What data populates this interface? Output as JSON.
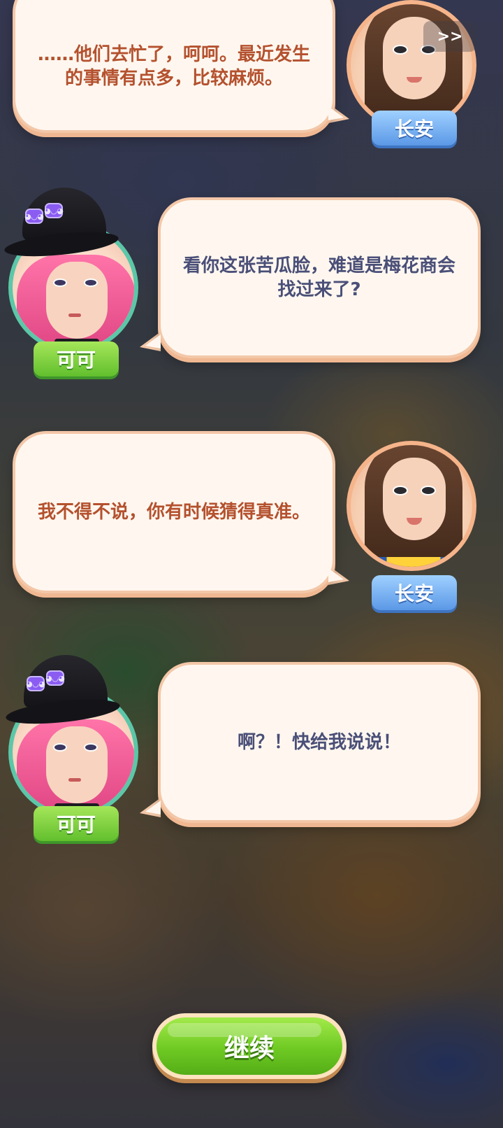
{
  "ui": {
    "skip_label": ">>",
    "continue_label": "继续"
  },
  "characters": {
    "changan": {
      "name": "长安"
    },
    "keke": {
      "name": "可可",
      "pin_glyph": "◕◡◕"
    }
  },
  "dialogue": [
    {
      "speaker": "长安",
      "text": "……他们去忙了，呵呵。最近发生的事情有点多，比较麻烦。"
    },
    {
      "speaker": "可可",
      "text": "看你这张苦瓜脸，难道是梅花商会找过来了?"
    },
    {
      "speaker": "长安",
      "text": "我不得不说，你有时候猜得真准。"
    },
    {
      "speaker": "可可",
      "text": "啊？！快给我说说！"
    }
  ],
  "colors": {
    "changan_text": "#b4512e",
    "keke_text": "#4a4f78",
    "bubble_fill": "#fff7ef",
    "bubble_border": "#f3c7a8",
    "continue_green": "#6fc923",
    "changan_tag": "#5b98e6",
    "keke_tag": "#62bf2d"
  }
}
